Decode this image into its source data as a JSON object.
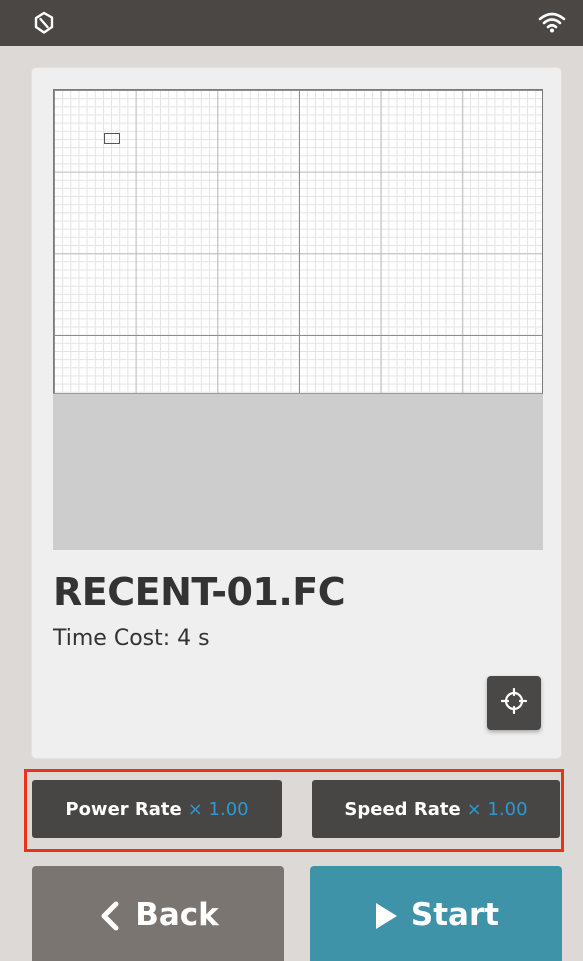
{
  "status_bar": {
    "logo_icon": "app-logo-icon",
    "wifi_icon": "wifi-icon"
  },
  "file": {
    "name": "RECENT-01.FC",
    "time_cost": "Time Cost: 4 s"
  },
  "rates": {
    "power_label": "Power Rate",
    "power_value": "× 1.00",
    "speed_label": "Speed Rate",
    "speed_value": "× 1.00"
  },
  "actions": {
    "back_label": "Back",
    "start_label": "Start"
  },
  "colors": {
    "status_bar": "#4a4745",
    "rate_value": "#2a9ad3",
    "back_button": "#7b7572",
    "start_button": "#3f93a8",
    "highlight": "#e8321c"
  }
}
